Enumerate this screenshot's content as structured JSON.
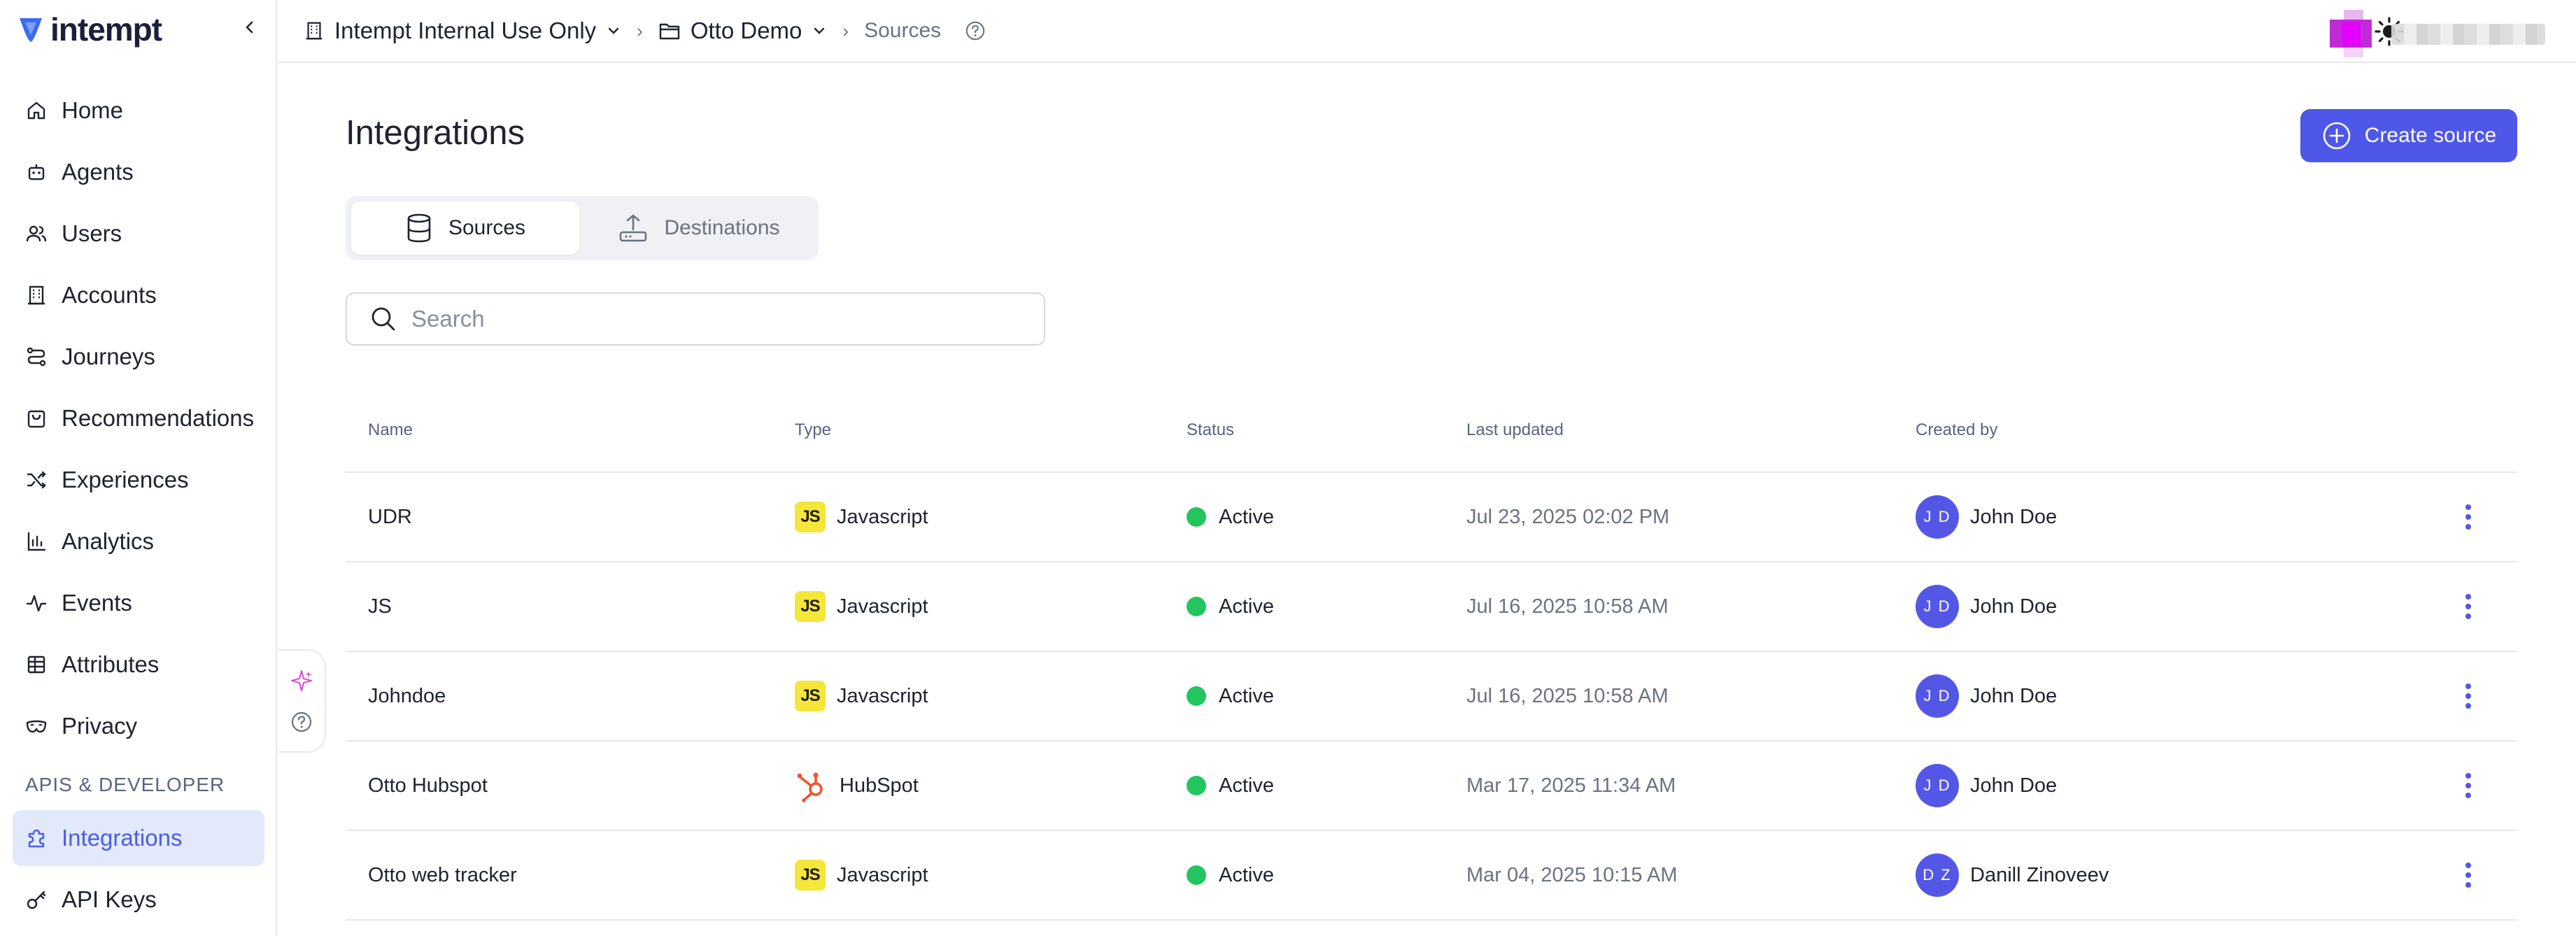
{
  "brand": {
    "name": "intempt"
  },
  "sidebar": {
    "items": [
      {
        "label": "Home",
        "icon": "home-icon"
      },
      {
        "label": "Agents",
        "icon": "robot-icon"
      },
      {
        "label": "Users",
        "icon": "users-icon"
      },
      {
        "label": "Accounts",
        "icon": "building-icon"
      },
      {
        "label": "Journeys",
        "icon": "route-icon"
      },
      {
        "label": "Recommendations",
        "icon": "bag-icon"
      },
      {
        "label": "Experiences",
        "icon": "shuffle-icon"
      },
      {
        "label": "Analytics",
        "icon": "bar-chart-icon"
      },
      {
        "label": "Events",
        "icon": "activity-icon"
      },
      {
        "label": "Attributes",
        "icon": "table-icon"
      },
      {
        "label": "Privacy",
        "icon": "mask-icon"
      }
    ],
    "section_label": "APIS & DEVELOPER",
    "dev_items": [
      {
        "label": "Integrations",
        "icon": "puzzle-icon",
        "active": true
      },
      {
        "label": "API Keys",
        "icon": "key-icon"
      }
    ]
  },
  "breadcrumb": {
    "org": "Intempt Internal Use Only",
    "project": "Otto Demo",
    "page": "Sources"
  },
  "main": {
    "title": "Integrations",
    "create_button": "Create source",
    "tabs": [
      {
        "label": "Sources",
        "icon": "database-icon",
        "active": true
      },
      {
        "label": "Destinations",
        "icon": "upload-icon",
        "active": false
      }
    ],
    "search": {
      "placeholder": "Search",
      "value": ""
    }
  },
  "table": {
    "columns": [
      "Name",
      "Type",
      "Status",
      "Last updated",
      "Created by"
    ],
    "rows": [
      {
        "name": "UDR",
        "type": "Javascript",
        "type_icon": "js",
        "status": "Active",
        "updated": "Jul 23, 2025 02:02 PM",
        "initials": "J D",
        "creator": "John Doe"
      },
      {
        "name": "JS",
        "type": "Javascript",
        "type_icon": "js",
        "status": "Active",
        "updated": "Jul 16, 2025 10:58 AM",
        "initials": "J D",
        "creator": "John Doe"
      },
      {
        "name": "Johndoe",
        "type": "Javascript",
        "type_icon": "js",
        "status": "Active",
        "updated": "Jul 16, 2025 10:58 AM",
        "initials": "J D",
        "creator": "John Doe"
      },
      {
        "name": "Otto Hubspot",
        "type": "HubSpot",
        "type_icon": "hubspot",
        "status": "Active",
        "updated": "Mar 17, 2025 11:34 AM",
        "initials": "J D",
        "creator": "John Doe"
      },
      {
        "name": "Otto web tracker",
        "type": "Javascript",
        "type_icon": "js",
        "status": "Active",
        "updated": "Mar 04, 2025 10:15 AM",
        "initials": "D Z",
        "creator": "Danill Zinoveev"
      }
    ],
    "js_badge_text": "JS"
  },
  "colors": {
    "accent": "#4f57e8",
    "active_nav_bg": "#e2e9fb",
    "status_active": "#22c55e",
    "hubspot": "#f0542e"
  }
}
